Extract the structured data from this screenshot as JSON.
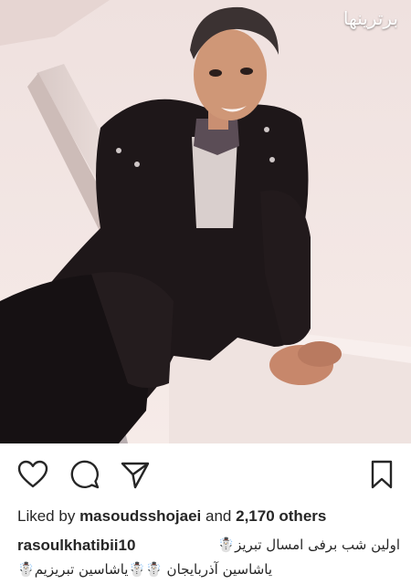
{
  "watermark": "برترینها",
  "photo": {
    "description_icon": "photo"
  },
  "actions": {
    "like_icon": "heart-outline-icon",
    "comment_icon": "comment-bubble-icon",
    "share_icon": "paper-plane-icon",
    "save_icon": "bookmark-icon"
  },
  "likes": {
    "prefix": "Liked by",
    "user": "masoudsshojaei",
    "middle": "and",
    "count": "2,170 others"
  },
  "caption": {
    "username": "rasoulkhatibii10",
    "line1": "اولین شب برفی امسال تبریز☃️",
    "line2": "☃️یاشاسین آذربایجان ☃️☃️یاشاسین تبریزیم"
  },
  "colors": {
    "text": "#262626",
    "snow": "#f3e6e3",
    "coat": "#1c1517"
  }
}
